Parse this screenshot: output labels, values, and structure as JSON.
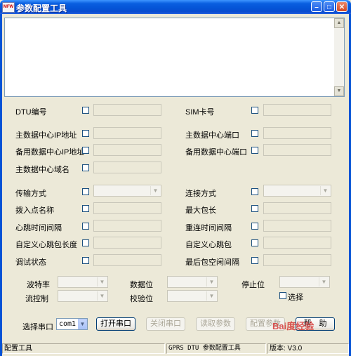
{
  "window": {
    "title": "参数配置工具",
    "app_icon_text": "MFW"
  },
  "fields": {
    "dtu_id": "DTU编号",
    "sim_card": "SIM卡号",
    "main_center_ip": "主数据中心IP地址",
    "main_center_port": "主数据中心端口",
    "backup_center_ip": "备用数据中心IP地址",
    "backup_center_port": "备用数据中心端口",
    "main_center_domain": "主数据中心域名",
    "transport_mode": "传输方式",
    "connect_mode": "连接方式",
    "apn_name": "拨入点名称",
    "max_packet_len": "最大包长",
    "heartbeat_interval": "心跳时间间隔",
    "reconnect_interval": "重连时间间隔",
    "custom_heartbeat_len": "自定义心跳包长度",
    "custom_heartbeat": "自定义心跳包",
    "debug_state": "调试状态",
    "last_packet_idle": "最后包空闲间隔"
  },
  "serial": {
    "baud_rate": "波特率",
    "data_bits": "数据位",
    "stop_bits": "停止位",
    "flow_control": "流控制",
    "parity": "校验位",
    "select_label": "选择",
    "port_label": "选择串口",
    "port_value": "com1"
  },
  "buttons": {
    "open_port": "打开串口",
    "close_port": "关闭串口",
    "read_params": "读取参数",
    "config_params": "配置参数",
    "help": "帮　助"
  },
  "status": {
    "left": "配置工具",
    "middle": "GPRS DTU 参数配置工具",
    "right": "版本: V3.0"
  },
  "watermark": "Bai度经验"
}
